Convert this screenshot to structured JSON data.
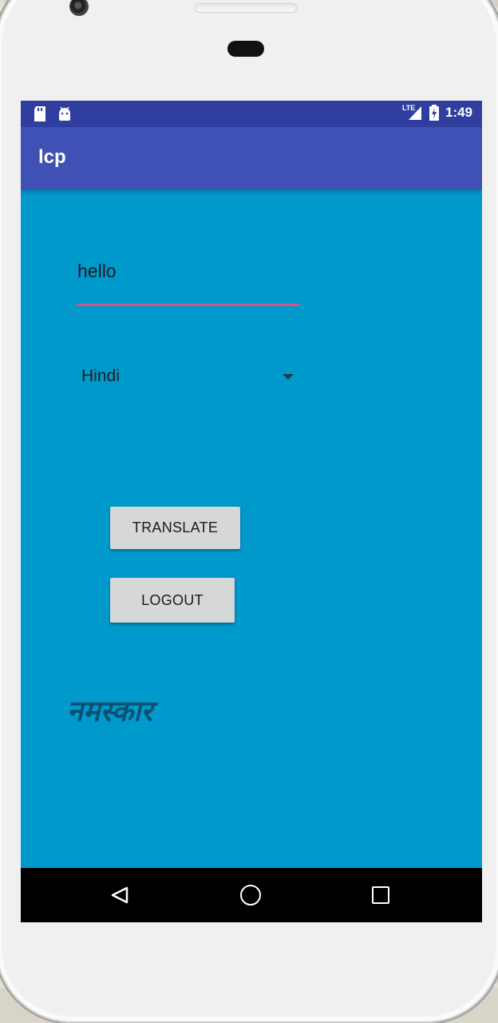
{
  "status_bar": {
    "network": "LTE",
    "time": "1:49"
  },
  "app_bar": {
    "title": "lcp"
  },
  "form": {
    "input_value": "hello",
    "language_selected": "Hindi",
    "translate_label": "TRANSLATE",
    "logout_label": "LOGOUT"
  },
  "result": {
    "text": "नमस्कार"
  },
  "colors": {
    "status_bar": "#303f9f",
    "app_bar": "#3f51b5",
    "background": "#0099cc",
    "accent": "#e04f8a"
  },
  "icons": [
    "sd-card-icon",
    "android-debug-icon",
    "lte-signal-icon",
    "battery-charging-icon",
    "back-icon",
    "home-icon",
    "recent-apps-icon"
  ]
}
